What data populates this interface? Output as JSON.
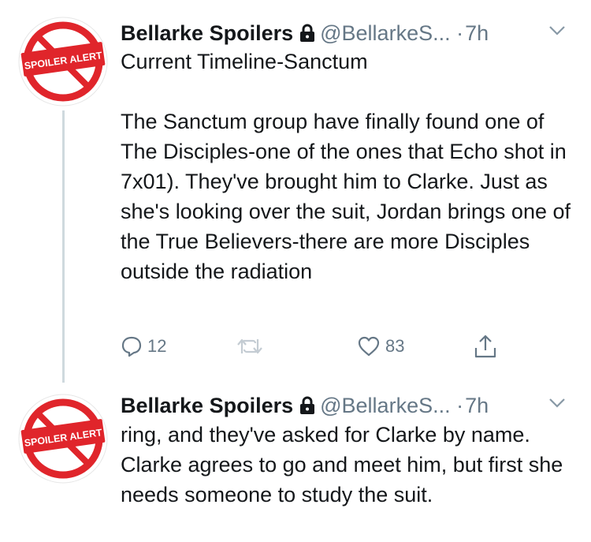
{
  "tweets": [
    {
      "display_name": "Bellarke Spoilers",
      "handle": "@BellarkeS...",
      "separator": "·",
      "time": "7h",
      "avatar_text": "SPOILER ALERT",
      "text": "Current Timeline-Sanctum\n\nThe Sanctum group have finally found one of The Disciples-one of the ones that Echo shot in 7x01). They've brought him to Clarke. Just as she's looking over the suit, Jordan brings one of the True Believers-there are more Disciples outside the radiation",
      "reply_count": "12",
      "retweet_count": "",
      "like_count": "83"
    },
    {
      "display_name": "Bellarke Spoilers",
      "handle": "@BellarkeS...",
      "separator": "·",
      "time": "7h",
      "avatar_text": "SPOILER ALERT",
      "text": "ring, and they've asked for Clarke by name. Clarke agrees to go and meet him, but first she needs someone to study the suit."
    }
  ],
  "colors": {
    "text": "#14171a",
    "muted": "#657786",
    "avatar_red": "#e0252b",
    "thread_line": "#cfd9de"
  }
}
